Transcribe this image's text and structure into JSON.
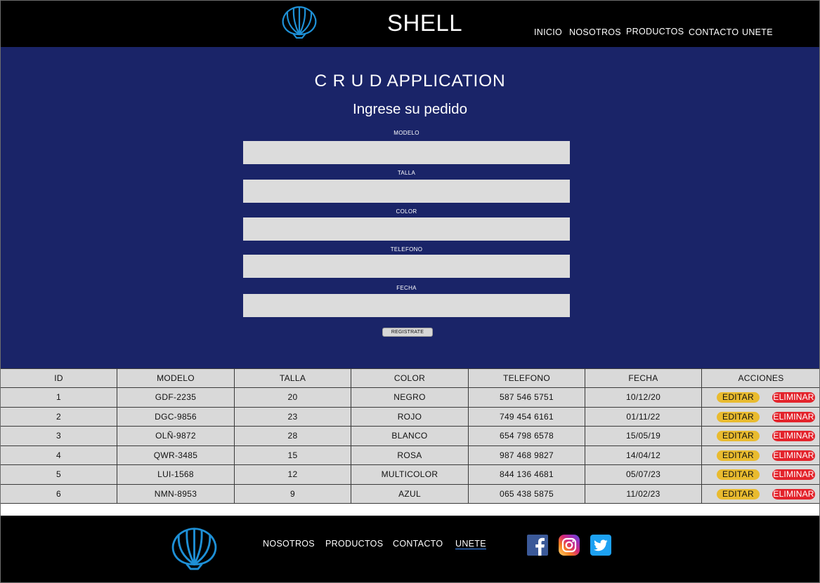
{
  "header": {
    "brand": "SHELL",
    "nav": [
      "INICIO",
      "NOSOTROS",
      "PRODUCTOS",
      "CONTACTO",
      "UNETE"
    ]
  },
  "form": {
    "title": "C R U D APPLICATION",
    "subtitle": "Ingrese su pedido",
    "fields": [
      {
        "label": "MODELO",
        "value": ""
      },
      {
        "label": "TALLA",
        "value": ""
      },
      {
        "label": "COLOR",
        "value": ""
      },
      {
        "label": "TELEFONO",
        "value": ""
      },
      {
        "label": "FECHA",
        "value": ""
      }
    ],
    "submit_label": "REGISTRATE"
  },
  "table": {
    "headers": [
      "ID",
      "MODELO",
      "TALLA",
      "COLOR",
      "TELEFONO",
      "FECHA",
      "ACCIONES"
    ],
    "edit_label": "EDITAR",
    "delete_label": "ELIMINAR",
    "rows": [
      [
        "1",
        "GDF-2235",
        "20",
        "NEGRO",
        "587 546 5751",
        "10/12/20"
      ],
      [
        "2",
        "DGC-9856",
        "23",
        "ROJO",
        "749 454 6161",
        "01/11/22"
      ],
      [
        "3",
        "OLÑ-9872",
        "28",
        "BLANCO",
        "654 798 6578",
        "15/05/19"
      ],
      [
        "4",
        "QWR-3485",
        "15",
        "ROSA",
        "987 468 9827",
        "14/04/12"
      ],
      [
        "5",
        "LUI-1568",
        "12",
        "MULTICOLOR",
        "844 136 4681",
        "05/07/23"
      ],
      [
        "6",
        "NMN-8953",
        "9",
        "AZUL",
        "065 438 5875",
        "11/02/23"
      ]
    ]
  },
  "footer": {
    "nav": [
      "NOSOTROS",
      "PRODUCTOS",
      "CONTACTO",
      "UNETE"
    ],
    "social_icons": [
      "facebook-icon",
      "instagram-icon",
      "twitter-icon"
    ]
  },
  "colors": {
    "header_bg": "#000000",
    "hero_bg": "#1a2468",
    "input_bg": "#dcdcdc",
    "table_cell_bg": "#d9d9d9",
    "edit_button": "#e9bb2f",
    "delete_button": "#e3232b",
    "logo_blue": "#1e90d6"
  }
}
